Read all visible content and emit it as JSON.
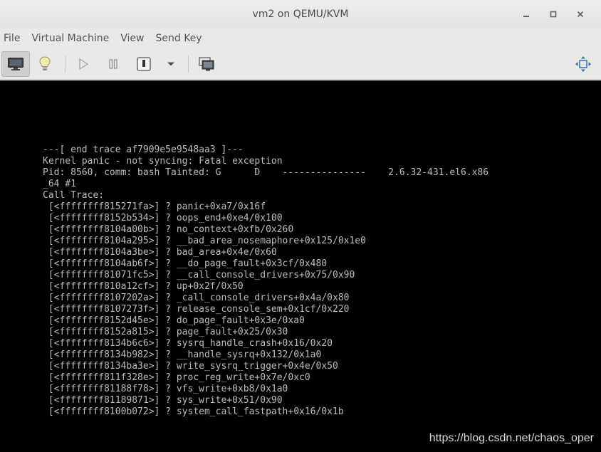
{
  "window": {
    "title": "vm2 on QEMU/KVM"
  },
  "menu": {
    "items": [
      {
        "label": "File"
      },
      {
        "label": "Virtual Machine"
      },
      {
        "label": "View"
      },
      {
        "label": "Send Key"
      }
    ]
  },
  "toolbar": {
    "buttons": [
      {
        "name": "console-view-button",
        "icon": "monitor-icon"
      },
      {
        "name": "details-view-button",
        "icon": "lightbulb-icon"
      },
      {
        "name": "run-button",
        "icon": "play-icon"
      },
      {
        "name": "pause-button",
        "icon": "pause-icon"
      },
      {
        "name": "shutdown-button",
        "icon": "power-icon"
      },
      {
        "name": "shutdown-menu-button",
        "icon": "chevron-down-icon"
      },
      {
        "name": "snapshots-button",
        "icon": "snapshot-icon"
      },
      {
        "name": "fullscreen-button",
        "icon": "fullscreen-icon"
      }
    ]
  },
  "console": {
    "lines": [
      "---[ end trace af7909e5e9548aa3 ]---",
      "Kernel panic - not syncing: Fatal exception",
      "Pid: 8560, comm: bash Tainted: G      D    ---------------    2.6.32-431.el6.x86",
      "_64 #1",
      "Call Trace:",
      " [<ffffffff815271fa>] ? panic+0xa7/0x16f",
      " [<ffffffff8152b534>] ? oops_end+0xe4/0x100",
      " [<ffffffff8104a00b>] ? no_context+0xfb/0x260",
      " [<ffffffff8104a295>] ? __bad_area_nosemaphore+0x125/0x1e0",
      " [<ffffffff8104a3be>] ? bad_area+0x4e/0x60",
      " [<ffffffff8104ab6f>] ? __do_page_fault+0x3cf/0x480",
      " [<ffffffff81071fc5>] ? __call_console_drivers+0x75/0x90",
      " [<ffffffff810a12cf>] ? up+0x2f/0x50",
      " [<ffffffff8107202a>] ? _call_console_drivers+0x4a/0x80",
      " [<ffffffff8107273f>] ? release_console_sem+0x1cf/0x220",
      " [<ffffffff8152d45e>] ? do_page_fault+0x3e/0xa0",
      " [<ffffffff8152a815>] ? page_fault+0x25/0x30",
      " [<ffffffff8134b6c6>] ? sysrq_handle_crash+0x16/0x20",
      " [<ffffffff8134b982>] ? __handle_sysrq+0x132/0x1a0",
      " [<ffffffff8134ba3e>] ? write_sysrq_trigger+0x4e/0x50",
      " [<ffffffff811f328e>] ? proc_reg_write+0x7e/0xc0",
      " [<ffffffff81188f78>] ? vfs_write+0xb8/0x1a0",
      " [<ffffffff81189871>] ? sys_write+0x51/0x90",
      " [<ffffffff8100b072>] ? system_call_fastpath+0x16/0x1b"
    ]
  },
  "watermark": "https://blog.csdn.net/chaos_oper",
  "colors": {
    "chrome_bg": "#e8e8e7",
    "console_bg": "#000000",
    "console_text": "#bdbdbd",
    "accent_blue": "#3a6ea5"
  }
}
